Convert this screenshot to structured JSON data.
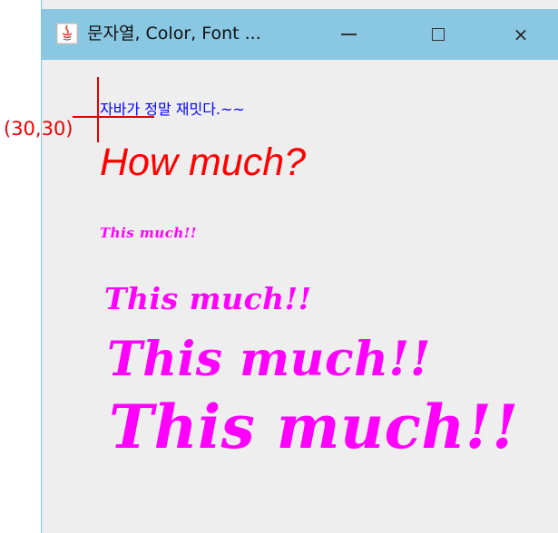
{
  "window": {
    "title": "문자열, Color, Font ...",
    "buttons": {
      "minimize": "minimize",
      "maximize": "maximize",
      "close": "×"
    }
  },
  "canvas": {
    "origin_label": "(30,30)",
    "korean_text": "자바가 정말 재밋다.~~",
    "how_much": "How much?",
    "this_much": "This much!!"
  },
  "colors": {
    "titlebar": "#8ac7e3",
    "background": "#eeeeee",
    "blue_text": "#0000ff",
    "red_text": "#ff0000",
    "magenta_text": "#ff00ff",
    "overlay_red": "#f00000"
  }
}
